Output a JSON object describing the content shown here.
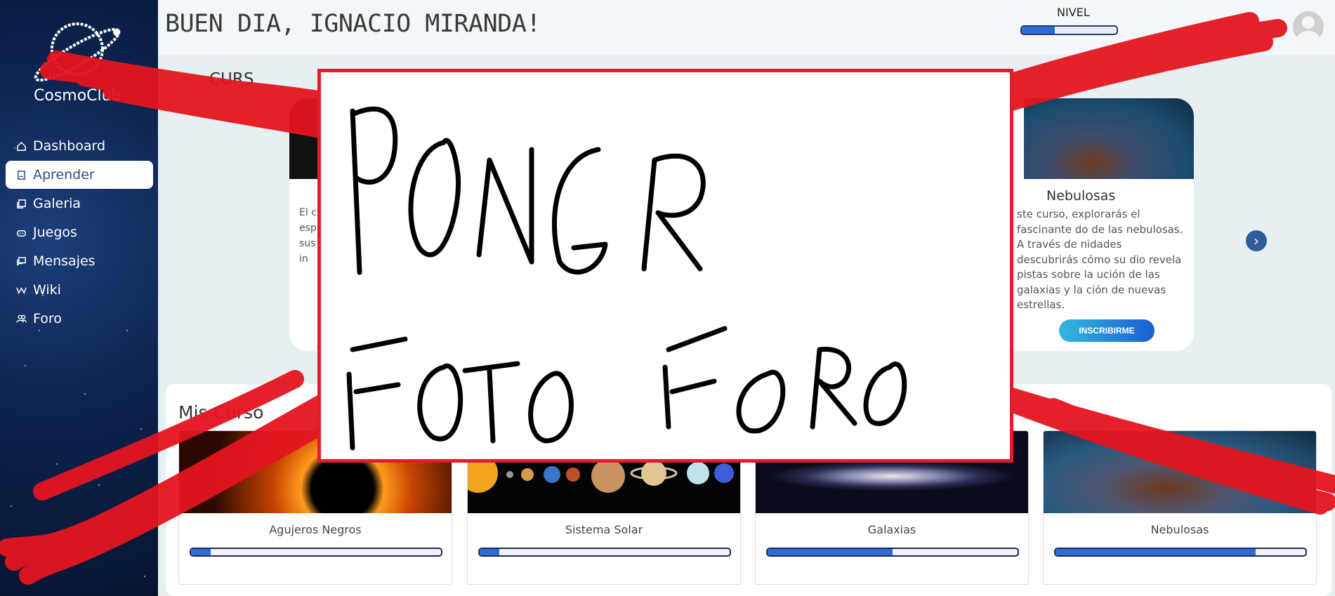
{
  "app": {
    "name": "CosmoClub"
  },
  "header": {
    "greeting": "BUEN DIA, IGNACIO MIRANDA!",
    "level_label": "NIVEL",
    "level_progress": 0.35
  },
  "sidebar": {
    "items": [
      {
        "label": "Dashboard",
        "icon": "home-icon",
        "active": false
      },
      {
        "label": "Aprender",
        "icon": "book-icon",
        "active": true
      },
      {
        "label": "Galeria",
        "icon": "gallery-icon",
        "active": false
      },
      {
        "label": "Juegos",
        "icon": "gamepad-icon",
        "active": false
      },
      {
        "label": "Mensajes",
        "icon": "messages-icon",
        "active": false
      },
      {
        "label": "Wiki",
        "icon": "wiki-icon",
        "active": false
      },
      {
        "label": "Foro",
        "icon": "users-icon",
        "active": false
      }
    ]
  },
  "featured": {
    "section_title_fragment": "CURS",
    "left_card_text": "El cu emo esp evo sus con la in",
    "right_card": {
      "title": "Nebulosas",
      "description": "ste curso, explorarás el fascinante do de las nebulosas. A través de nidades descubrirás cómo su dio revela pistas sobre la ución de las galaxias y la ción de nuevas estrellas.",
      "button": "INSCRIBIRME"
    }
  },
  "my_courses": {
    "title": "Mis Curso",
    "courses": [
      {
        "name": "Agujeros Negros",
        "progress": 0.08
      },
      {
        "name": "Sistema Solar",
        "progress": 0.08
      },
      {
        "name": "Galaxias",
        "progress": 0.5
      },
      {
        "name": "Nebulosas",
        "progress": 0.8
      }
    ]
  },
  "overlay": {
    "line1": "PONER",
    "line2": "FOTO FORO"
  }
}
